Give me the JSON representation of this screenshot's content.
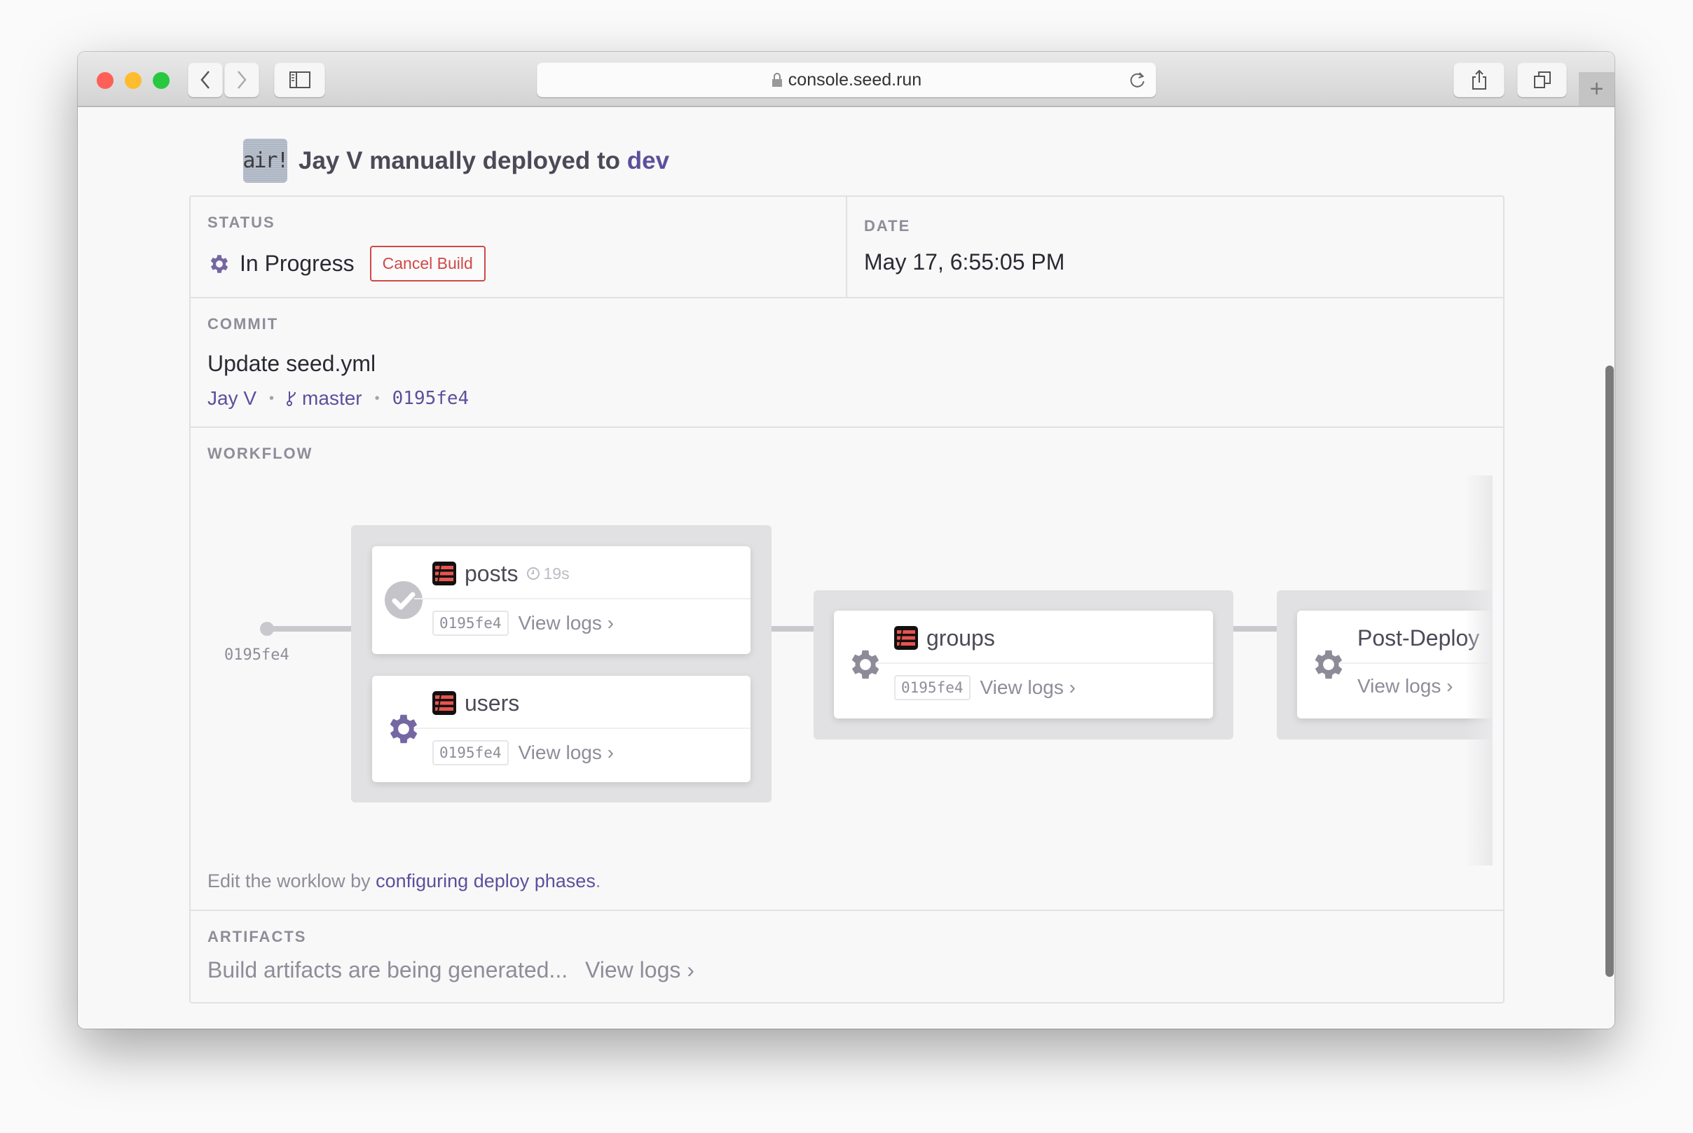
{
  "browser": {
    "url": "console.seed.run",
    "buttons": {
      "back": "back",
      "forward": "forward",
      "sidebar": "sidebar",
      "share": "share",
      "tabs": "tabs",
      "new_tab": "+"
    },
    "traffic_lights": [
      "#fe5f57",
      "#febc2e",
      "#28c840"
    ]
  },
  "header": {
    "avatar_text": "air!",
    "actor": "Jay V",
    "action": " manually deployed to ",
    "stage": "dev"
  },
  "status": {
    "label": "STATUS",
    "value": "In Progress",
    "cancel_label": "Cancel Build"
  },
  "date": {
    "label": "DATE",
    "value": "May 17, 6:55:05 PM"
  },
  "commit": {
    "label": "COMMIT",
    "message": "Update seed.yml",
    "author": "Jay V",
    "branch": "master",
    "sha": "0195fe4"
  },
  "workflow": {
    "label": "WORKFLOW",
    "start_label": "0195fe4",
    "stages": [
      {
        "services": [
          {
            "name": "posts",
            "status": "success",
            "duration": "19s",
            "sha": "0195fe4",
            "logs": "View logs"
          },
          {
            "name": "users",
            "status": "in-progress",
            "sha": "0195fe4",
            "logs": "View logs"
          }
        ]
      },
      {
        "services": [
          {
            "name": "groups",
            "status": "pending",
            "sha": "0195fe4",
            "logs": "View logs"
          }
        ]
      },
      {
        "services": [
          {
            "name": "Post-Deploy",
            "status": "pending",
            "logs": "View logs"
          }
        ]
      }
    ],
    "note_prefix": "Edit the worklow by ",
    "note_link": "configuring deploy phases",
    "note_suffix": "."
  },
  "artifacts": {
    "label": "ARTIFACTS",
    "text": "Build artifacts are being generated...",
    "logs": "View logs"
  },
  "colors": {
    "accent": "#5e4f9c",
    "gear_active": "#7567a2",
    "gear_pending": "#8e8b98",
    "danger": "#d04848"
  }
}
